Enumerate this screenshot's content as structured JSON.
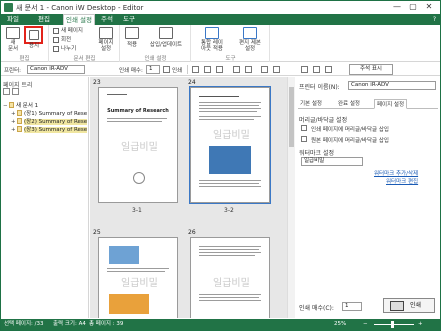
{
  "app": {
    "title": "새 문서 1 - Canon iW Desktop - Editor",
    "window_controls": {
      "minimize": "—",
      "maximize": "▢",
      "close": "✕"
    }
  },
  "ribbon_tabs": [
    "파일",
    "편집 ",
    "인쇄 설정",
    "주석",
    "도구"
  ],
  "ribbon_right": "?",
  "ribbon": {
    "groups": [
      {
        "label": "편집"
      },
      {
        "label": "문서 편집"
      },
      {
        "label": "인쇄 설정"
      },
      {
        "label": "도구"
      }
    ],
    "buttons": {
      "new": "새\n문서",
      "paper": "용지",
      "new_page": "새 페이지",
      "rotate": "회전",
      "split": "나누기",
      "page_settings": "페이지\n설정",
      "apply": "적용",
      "insert_update": "삽입/업데이트",
      "delete": "삭제",
      "binding_layout": "통합 레이\n아웃 적용",
      "edit_binding": "편지 제본\n설정",
      "tools": "도구"
    }
  },
  "toolbar2": {
    "printer_label": "프린터:",
    "printer_value": "Canon iR-ADV",
    "copies_label": "인쇄 매수:",
    "copies_value": "1",
    "zoom_value": "인쇄",
    "print_settings_button": "주석 표시"
  },
  "left_pane": {
    "title": "페이지 트리",
    "tree": [
      {
        "label": "새 문서 1",
        "level": 0,
        "expander": "−",
        "selected": false
      },
      {
        "label": "(장1) Summary of Rese",
        "level": 1,
        "expander": "+",
        "selected": false
      },
      {
        "label": "(장2) Summary of Rese",
        "level": 1,
        "expander": "+",
        "selected": true
      },
      {
        "label": "(장3) Summary of Rese",
        "level": 1,
        "expander": "+",
        "selected": true
      }
    ]
  },
  "center": {
    "pages": [
      {
        "num": "23",
        "caption": "3-1",
        "heading": "Summary of Research",
        "watermark": "일급비밀"
      },
      {
        "num": "24",
        "caption": "3-2",
        "heading": "",
        "watermark": "일급비밀"
      },
      {
        "num": "25",
        "caption": "",
        "heading": "",
        "watermark": "일급비밀"
      },
      {
        "num": "26",
        "caption": "",
        "heading": "",
        "watermark": "일급비밀"
      }
    ],
    "selected_page": "3-2"
  },
  "right_pane": {
    "printer_label": "프린터 이름(N):",
    "printer_value": "Canon iR-ADV",
    "tabs": [
      "기본 설정",
      "완료 설정",
      "페이지 설정"
    ],
    "active_tab": "페이지 설정",
    "header_footer_section": "머리글/바닥글 설정",
    "checkboxes": [
      {
        "label": "인쇄 페이지에 머리글/바닥글 삽입",
        "checked": false
      },
      {
        "label": "원본 페이지에 머리글/바닥글 삽입",
        "checked": false
      }
    ],
    "watermark_section": "워터마크 설정",
    "watermark_value": "일급비밀",
    "links": [
      "워터마크 추가/삭제",
      "워터마크 편집"
    ],
    "copies_label": "인쇄 매수(C):",
    "copies_value": "1",
    "print_button": "인쇄"
  },
  "status": {
    "selected_page": "선택 페이지: /33",
    "output_size": "출력 크기: A4",
    "total_pages": "총 페이지 : 39",
    "zoom": "25%",
    "accent": "#217346"
  }
}
